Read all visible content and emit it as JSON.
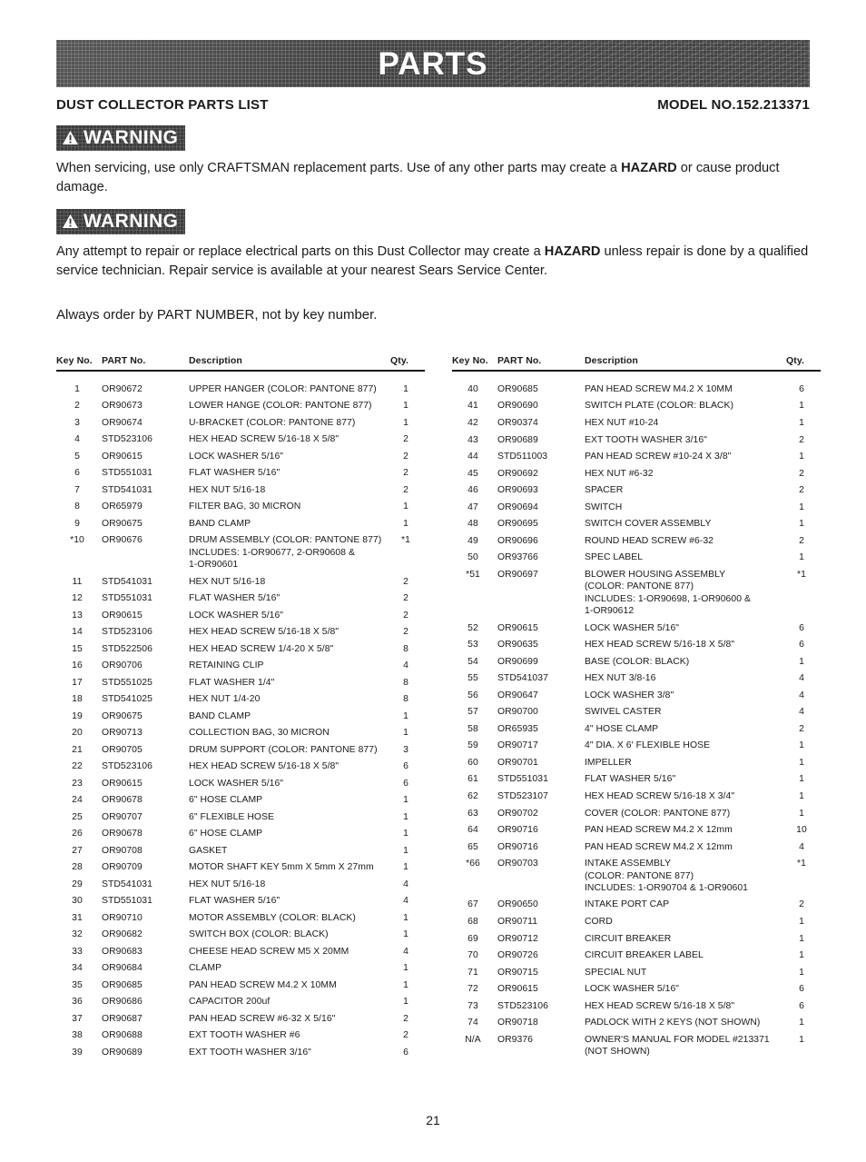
{
  "banner": {
    "title": "PARTS"
  },
  "subhead": {
    "left": "DUST COLLECTOR PARTS LIST",
    "right": "MODEL NO.152.213371"
  },
  "warnings": [
    {
      "badge_label": "WARNING",
      "body_pre": "When servicing, use only CRAFTSMAN replacement parts. Use of any other parts may create a ",
      "body_bold": "HAZARD",
      "body_post": " or cause product damage."
    },
    {
      "badge_label": "WARNING",
      "body_pre": "Any attempt to repair or replace electrical parts on this Dust Collector may create a ",
      "body_bold": "HAZARD",
      "body_post": " unless repair is done by a qualified service technician. Repair service is available at your nearest Sears Service Center."
    }
  ],
  "order_note": "Always order by PART NUMBER, not by key number.",
  "table_headers": {
    "key": "Key No.",
    "part": "PART No.",
    "description": "Description",
    "qty": "Qty."
  },
  "left_rows": [
    {
      "key": "1",
      "part": "OR90672",
      "desc": "UPPER HANGER (COLOR: PANTONE 877)",
      "qty": "1"
    },
    {
      "key": "2",
      "part": "OR90673",
      "desc": "LOWER HANGE (COLOR: PANTONE 877)",
      "qty": "1"
    },
    {
      "key": "3",
      "part": "OR90674",
      "desc": "U-BRACKET (COLOR: PANTONE 877)",
      "qty": "1"
    },
    {
      "key": "4",
      "part": "STD523106",
      "desc": "HEX HEAD SCREW 5/16-18 X 5/8\"",
      "qty": "2"
    },
    {
      "key": "5",
      "part": "OR90615",
      "desc": "LOCK WASHER 5/16\"",
      "qty": "2"
    },
    {
      "key": "6",
      "part": "STD551031",
      "desc": "FLAT WASHER 5/16\"",
      "qty": "2"
    },
    {
      "key": "7",
      "part": "STD541031",
      "desc": "HEX NUT 5/16-18",
      "qty": "2"
    },
    {
      "key": "8",
      "part": "OR65979",
      "desc": "FILTER BAG, 30 MICRON",
      "qty": "1"
    },
    {
      "key": "9",
      "part": "OR90675",
      "desc": "BAND CLAMP",
      "qty": "1"
    },
    {
      "key": "*10",
      "part": "OR90676",
      "desc": "DRUM ASSEMBLY (COLOR: PANTONE 877)",
      "desc2": "INCLUDES: 1-OR90677, 2-OR90608 &",
      "desc3": "1-OR90601",
      "qty": "*1"
    },
    {
      "key": "11",
      "part": "STD541031",
      "desc": "HEX NUT 5/16-18",
      "qty": "2"
    },
    {
      "key": "12",
      "part": "STD551031",
      "desc": "FLAT WASHER 5/16\"",
      "qty": "2"
    },
    {
      "key": "13",
      "part": "OR90615",
      "desc": "LOCK WASHER 5/16\"",
      "qty": "2"
    },
    {
      "key": "14",
      "part": "STD523106",
      "desc": "HEX HEAD SCREW 5/16-18 X 5/8\"",
      "qty": "2"
    },
    {
      "key": "15",
      "part": "STD522506",
      "desc": "HEX HEAD SCREW 1/4-20 X 5/8\"",
      "qty": "8"
    },
    {
      "key": "16",
      "part": "OR90706",
      "desc": "RETAINING CLIP",
      "qty": "4"
    },
    {
      "key": "17",
      "part": "STD551025",
      "desc": "FLAT WASHER 1/4\"",
      "qty": "8"
    },
    {
      "key": "18",
      "part": "STD541025",
      "desc": "HEX NUT 1/4-20",
      "qty": "8"
    },
    {
      "key": "19",
      "part": "OR90675",
      "desc": "BAND CLAMP",
      "qty": "1"
    },
    {
      "key": "20",
      "part": "OR90713",
      "desc": "COLLECTION BAG, 30 MICRON",
      "qty": "1"
    },
    {
      "key": "21",
      "part": "OR90705",
      "desc": "DRUM SUPPORT (COLOR: PANTONE 877)",
      "qty": "3"
    },
    {
      "key": "22",
      "part": "STD523106",
      "desc": "HEX HEAD SCREW 5/16-18 X 5/8\"",
      "qty": "6"
    },
    {
      "key": "23",
      "part": "OR90615",
      "desc": "LOCK WASHER 5/16\"",
      "qty": "6"
    },
    {
      "key": "24",
      "part": "OR90678",
      "desc": "6\" HOSE CLAMP",
      "qty": "1"
    },
    {
      "key": "25",
      "part": "OR90707",
      "desc": "6\" FLEXIBLE HOSE",
      "qty": "1"
    },
    {
      "key": "26",
      "part": "OR90678",
      "desc": "6\" HOSE CLAMP",
      "qty": "1"
    },
    {
      "key": "27",
      "part": "OR90708",
      "desc": "GASKET",
      "qty": "1"
    },
    {
      "key": "28",
      "part": "OR90709",
      "desc": "MOTOR SHAFT KEY 5mm X 5mm X 27mm",
      "qty": "1"
    },
    {
      "key": "29",
      "part": "STD541031",
      "desc": "HEX NUT 5/16-18",
      "qty": "4"
    },
    {
      "key": "30",
      "part": "STD551031",
      "desc": "FLAT WASHER 5/16\"",
      "qty": "4"
    },
    {
      "key": "31",
      "part": "OR90710",
      "desc": "MOTOR ASSEMBLY (COLOR: BLACK)",
      "qty": "1"
    },
    {
      "key": "32",
      "part": "OR90682",
      "desc": "SWITCH BOX (COLOR: BLACK)",
      "qty": "1"
    },
    {
      "key": "33",
      "part": "OR90683",
      "desc": "CHEESE HEAD SCREW M5 X 20MM",
      "qty": "4"
    },
    {
      "key": "34",
      "part": "OR90684",
      "desc": "CLAMP",
      "qty": "1"
    },
    {
      "key": "35",
      "part": "OR90685",
      "desc": "PAN HEAD SCREW M4.2 X 10MM",
      "qty": "1"
    },
    {
      "key": "36",
      "part": "OR90686",
      "desc": "CAPACITOR 200uf",
      "qty": "1"
    },
    {
      "key": "37",
      "part": "OR90687",
      "desc": "PAN HEAD SCREW #6-32 X 5/16\"",
      "qty": "2"
    },
    {
      "key": "38",
      "part": "OR90688",
      "desc": "EXT TOOTH WASHER #6",
      "qty": "2"
    },
    {
      "key": "39",
      "part": "OR90689",
      "desc": "EXT TOOTH WASHER 3/16\"",
      "qty": "6"
    }
  ],
  "right_rows": [
    {
      "key": "40",
      "part": "OR90685",
      "desc": "PAN HEAD SCREW M4.2 X 10MM",
      "qty": "6"
    },
    {
      "key": "41",
      "part": "OR90690",
      "desc": "SWITCH PLATE (COLOR: BLACK)",
      "qty": "1"
    },
    {
      "key": "42",
      "part": "OR90374",
      "desc": "HEX NUT #10-24",
      "qty": "1"
    },
    {
      "key": "43",
      "part": "OR90689",
      "desc": "EXT TOOTH WASHER 3/16\"",
      "qty": "2"
    },
    {
      "key": "44",
      "part": "STD511003",
      "desc": "PAN HEAD SCREW #10-24 X 3/8\"",
      "qty": "1"
    },
    {
      "key": "45",
      "part": "OR90692",
      "desc": "HEX NUT #6-32",
      "qty": "2"
    },
    {
      "key": "46",
      "part": "OR90693",
      "desc": "SPACER",
      "qty": "2"
    },
    {
      "key": "47",
      "part": "OR90694",
      "desc": "SWITCH",
      "qty": "1"
    },
    {
      "key": "48",
      "part": "OR90695",
      "desc": "SWITCH COVER ASSEMBLY",
      "qty": "1"
    },
    {
      "key": "49",
      "part": "OR90696",
      "desc": "ROUND HEAD SCREW #6-32",
      "qty": "2"
    },
    {
      "key": "50",
      "part": "OR93766",
      "desc": "SPEC LABEL",
      "qty": "1"
    },
    {
      "key": "*51",
      "part": "OR90697",
      "desc": "BLOWER HOUSING ASSEMBLY",
      "desc2": "(COLOR: PANTONE 877)",
      "desc3": "INCLUDES: 1-OR90698, 1-OR90600 &",
      "desc4": "1-OR90612",
      "qty": "*1"
    },
    {
      "key": "52",
      "part": "OR90615",
      "desc": "LOCK WASHER 5/16\"",
      "qty": "6"
    },
    {
      "key": "53",
      "part": "OR90635",
      "desc": "HEX HEAD SCREW 5/16-18 X 5/8\"",
      "qty": "6"
    },
    {
      "key": "54",
      "part": "OR90699",
      "desc": "BASE (COLOR: BLACK)",
      "qty": "1"
    },
    {
      "key": "55",
      "part": "STD541037",
      "desc": "HEX NUT 3/8-16",
      "qty": "4"
    },
    {
      "key": "56",
      "part": "OR90647",
      "desc": "LOCK WASHER 3/8\"",
      "qty": "4"
    },
    {
      "key": "57",
      "part": "OR90700",
      "desc": "SWIVEL CASTER",
      "qty": "4"
    },
    {
      "key": "58",
      "part": "OR65935",
      "desc": "4\" HOSE CLAMP",
      "qty": "2"
    },
    {
      "key": "59",
      "part": "OR90717",
      "desc": "4\" DIA. X 6' FLEXIBLE HOSE",
      "qty": "1"
    },
    {
      "key": "60",
      "part": "OR90701",
      "desc": "IMPELLER",
      "qty": "1"
    },
    {
      "key": "61",
      "part": "STD551031",
      "desc": "FLAT WASHER 5/16\"",
      "qty": "1"
    },
    {
      "key": "62",
      "part": "STD523107",
      "desc": "HEX HEAD SCREW 5/16-18 X 3/4\"",
      "qty": "1"
    },
    {
      "key": "63",
      "part": "OR90702",
      "desc": "COVER (COLOR: PANTONE 877)",
      "qty": "1"
    },
    {
      "key": "64",
      "part": "OR90716",
      "desc": "PAN HEAD SCREW M4.2 X 12mm",
      "qty": "10"
    },
    {
      "key": "65",
      "part": "OR90716",
      "desc": "PAN HEAD SCREW M4.2 X 12mm",
      "qty": "4"
    },
    {
      "key": "*66",
      "part": "OR90703",
      "desc": "INTAKE ASSEMBLY",
      "desc2": "(COLOR: PANTONE 877)",
      "desc3": "INCLUDES: 1-OR90704 & 1-OR90601",
      "qty": "*1"
    },
    {
      "key": "67",
      "part": "OR90650",
      "desc": "INTAKE PORT CAP",
      "qty": "2"
    },
    {
      "key": "68",
      "part": "OR90711",
      "desc": "CORD",
      "qty": "1"
    },
    {
      "key": "69",
      "part": "OR90712",
      "desc": "CIRCUIT BREAKER",
      "qty": "1"
    },
    {
      "key": "70",
      "part": "OR90726",
      "desc": "CIRCUIT BREAKER LABEL",
      "qty": "1"
    },
    {
      "key": "71",
      "part": "OR90715",
      "desc": "SPECIAL NUT",
      "qty": "1"
    },
    {
      "key": "72",
      "part": "OR90615",
      "desc": "LOCK WASHER 5/16\"",
      "qty": "6"
    },
    {
      "key": "73",
      "part": "STD523106",
      "desc": "HEX HEAD SCREW 5/16-18 X 5/8\"",
      "qty": "6"
    },
    {
      "key": "74",
      "part": "OR90718",
      "desc": "PADLOCK WITH 2 KEYS (NOT SHOWN)",
      "qty": "1"
    },
    {
      "key": "N/A",
      "part": "OR9376",
      "desc": "OWNER'S MANUAL FOR MODEL #213371",
      "desc2": "(NOT SHOWN)",
      "qty": "1"
    }
  ],
  "page_number": "21"
}
